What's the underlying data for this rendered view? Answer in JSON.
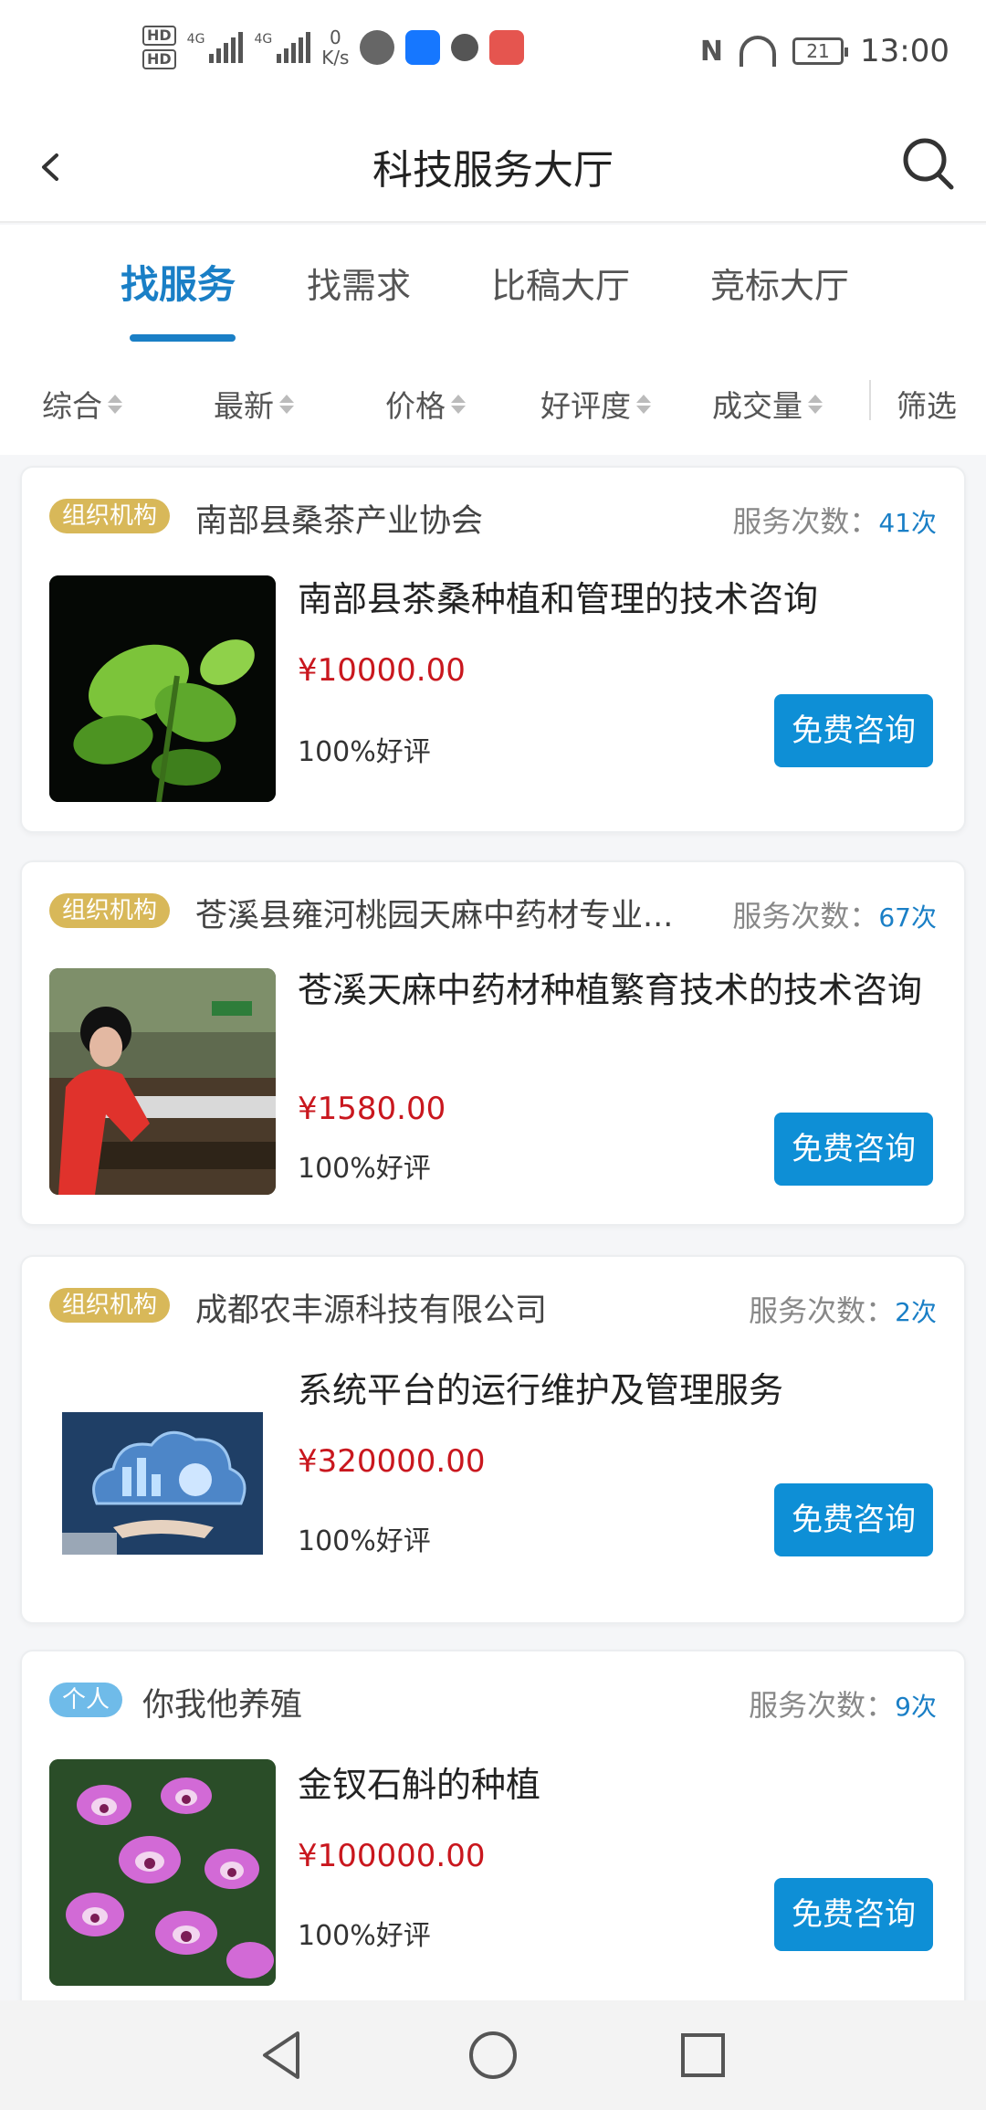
{
  "status_bar": {
    "hd1": "HD",
    "hd2": "HD",
    "sig1": "4G",
    "sig2": "4G",
    "speed_value": "0",
    "speed_unit": "K/s",
    "battery": "21",
    "time": "13:00"
  },
  "header": {
    "title": "科技服务大厅"
  },
  "tabs": [
    {
      "label": "找服务",
      "active": true
    },
    {
      "label": "找需求",
      "active": false
    },
    {
      "label": "比稿大厅",
      "active": false
    },
    {
      "label": "竞标大厅",
      "active": false
    }
  ],
  "sort": {
    "items": [
      "综合",
      "最新",
      "价格",
      "好评度",
      "成交量"
    ],
    "filter": "筛选"
  },
  "cards": [
    {
      "tag": "组织机构",
      "org": "南部县桑茶产业协会",
      "count_label": "服务次数：",
      "count_value": "41次",
      "title": "南部县茶桑种植和管理的技术咨询",
      "price": "¥10000.00",
      "rating": "100%好评",
      "button": "免费咨询"
    },
    {
      "tag": "组织机构",
      "org": "苍溪县雍河桃园天麻中药材专业...",
      "count_label": "服务次数：",
      "count_value": "67次",
      "title": "苍溪天麻中药材种植繁育技术的技术咨询",
      "price": "¥1580.00",
      "rating": "100%好评",
      "button": "免费咨询"
    },
    {
      "tag": "组织机构",
      "org": "成都农丰源科技有限公司",
      "count_label": "服务次数：",
      "count_value": "2次",
      "title": "系统平台的运行维护及管理服务",
      "price": "¥320000.00",
      "rating": "100%好评",
      "button": "免费咨询"
    },
    {
      "tag": "个人",
      "org": "你我他养殖",
      "count_label": "服务次数：",
      "count_value": "9次",
      "title": "金钗石斛的种植",
      "price": "¥100000.00",
      "rating": "100%好评",
      "button": "免费咨询"
    }
  ],
  "colors": {
    "accent": "#1a7fc6",
    "button": "#0e8fd6",
    "price": "#c9171e",
    "org_tag": "#d8b859",
    "person_tag": "#6fbbe9"
  }
}
